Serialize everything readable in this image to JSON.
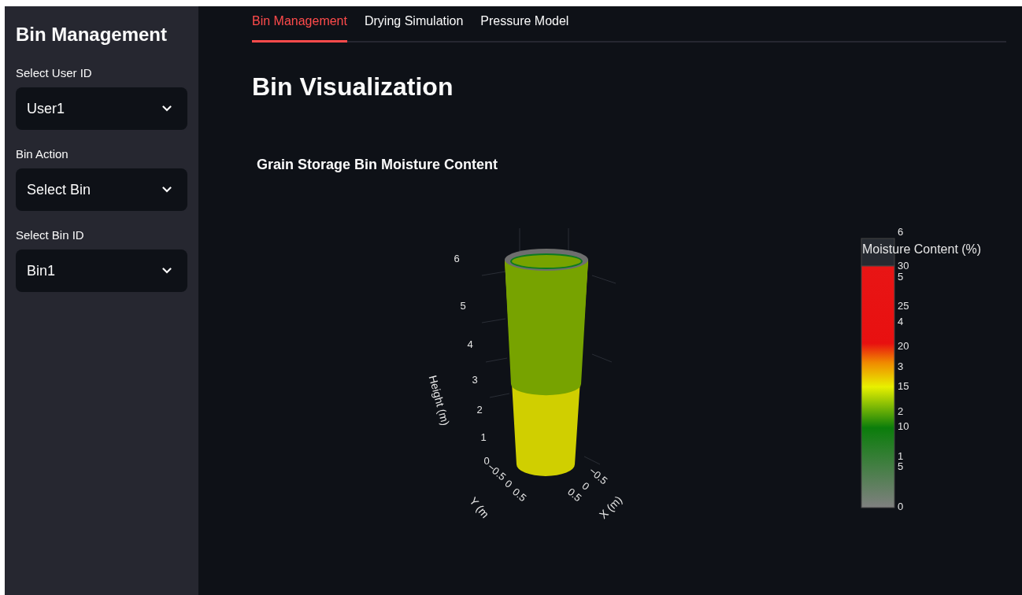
{
  "sidebar": {
    "title": "Bin Management",
    "fields": [
      {
        "label": "Select User ID",
        "value": "User1"
      },
      {
        "label": "Bin Action",
        "value": "Select Bin"
      },
      {
        "label": "Select Bin ID",
        "value": "Bin1"
      }
    ]
  },
  "tabs": [
    {
      "label": "Bin Management",
      "selected": true
    },
    {
      "label": "Drying Simulation",
      "selected": false
    },
    {
      "label": "Pressure Model",
      "selected": false
    }
  ],
  "page_title": "Bin Visualization",
  "chart": {
    "title": "Grain Storage Bin Moisture Content",
    "z_axis": {
      "title": "Height (m)",
      "ticks": [
        "6",
        "5",
        "4",
        "3",
        "2",
        "1",
        "0"
      ]
    },
    "y_axis": {
      "title": "Y (m",
      "ticks": [
        "−0.5",
        "0",
        "0.5"
      ]
    },
    "x_axis": {
      "title": "X (m)",
      "ticks": [
        "−0.5",
        "0",
        "0.5"
      ]
    },
    "colorbar": {
      "title": "Moisture Content (%)",
      "ticks": [
        "30",
        "25",
        "20",
        "15",
        "10",
        "5",
        "0"
      ],
      "height_ticks": [
        "6",
        "5",
        "4",
        "3",
        "2",
        "1"
      ]
    }
  }
}
